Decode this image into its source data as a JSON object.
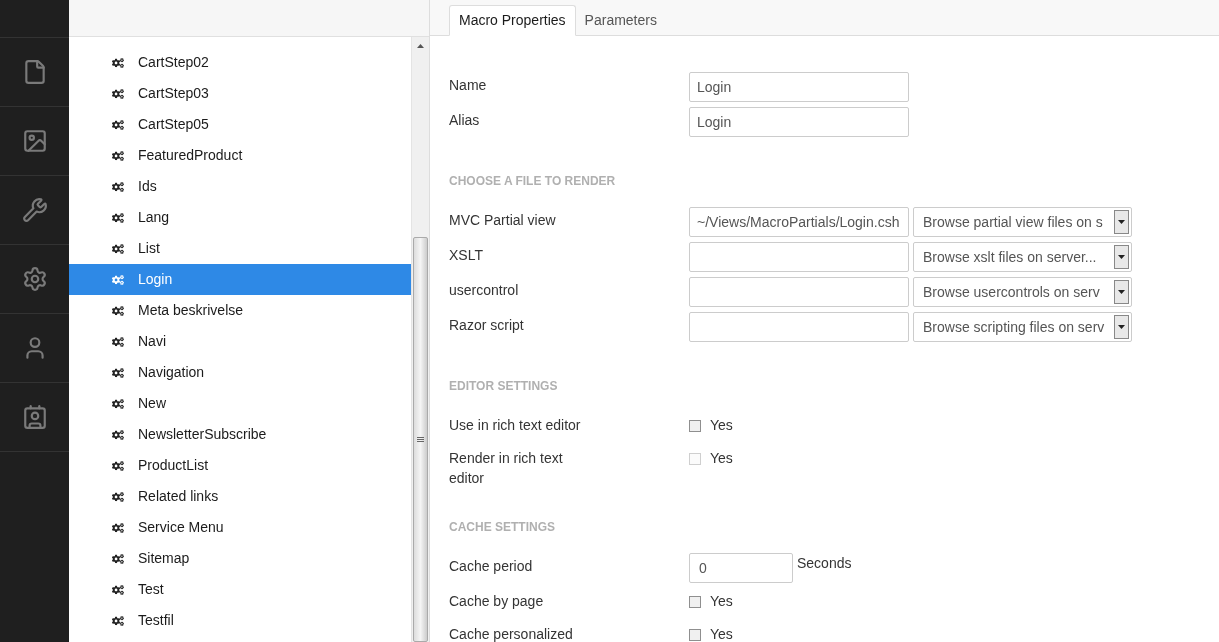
{
  "tree": {
    "items": [
      {
        "label": "CartStep02",
        "selected": false
      },
      {
        "label": "CartStep03",
        "selected": false
      },
      {
        "label": "CartStep05",
        "selected": false
      },
      {
        "label": "FeaturedProduct",
        "selected": false
      },
      {
        "label": "Ids",
        "selected": false
      },
      {
        "label": "Lang",
        "selected": false
      },
      {
        "label": "List",
        "selected": false
      },
      {
        "label": "Login",
        "selected": true
      },
      {
        "label": "Meta beskrivelse",
        "selected": false
      },
      {
        "label": "Navi",
        "selected": false
      },
      {
        "label": "Navigation",
        "selected": false
      },
      {
        "label": "New",
        "selected": false
      },
      {
        "label": "NewsletterSubscribe",
        "selected": false
      },
      {
        "label": "ProductList",
        "selected": false
      },
      {
        "label": "Related links",
        "selected": false
      },
      {
        "label": "Service Menu",
        "selected": false
      },
      {
        "label": "Sitemap",
        "selected": false
      },
      {
        "label": "Test",
        "selected": false
      },
      {
        "label": "Testfil",
        "selected": false
      }
    ]
  },
  "tabs": [
    {
      "label": "Macro Properties",
      "selected": true
    },
    {
      "label": "Parameters",
      "selected": false
    }
  ],
  "sections": [
    {
      "rows": [
        {
          "kind": "text",
          "label": "Name",
          "value": "Login"
        },
        {
          "kind": "text",
          "label": "Alias",
          "value": "Login"
        }
      ]
    },
    {
      "heading": "CHOOSE A FILE TO RENDER",
      "rows": [
        {
          "kind": "file",
          "label": "MVC Partial view",
          "value": "~/Views/MacroPartials/Login.csh",
          "browse": "Browse partial view files on s"
        },
        {
          "kind": "file",
          "label": "XSLT",
          "browse": "Browse xslt files on server..."
        },
        {
          "kind": "file",
          "label": "usercontrol",
          "browse": "Browse usercontrols on serv"
        },
        {
          "kind": "file",
          "label": "Razor script",
          "browse": "Browse scripting files on serv"
        }
      ]
    },
    {
      "heading": "EDITOR SETTINGS",
      "rows": [
        {
          "kind": "checkbox",
          "label": "Use in rich text editor",
          "option": "Yes",
          "checked": false,
          "disabled": false
        },
        {
          "kind": "checkbox",
          "label": "Render in rich text editor",
          "option": "Yes",
          "checked": false,
          "disabled": true
        }
      ]
    },
    {
      "heading": "CACHE SETTINGS",
      "rows": [
        {
          "kind": "number",
          "label": "Cache period",
          "value": "0",
          "unit": "Seconds"
        },
        {
          "kind": "checkbox",
          "label": "Cache by page",
          "option": "Yes",
          "checked": false,
          "disabled": false
        },
        {
          "kind": "checkbox",
          "label": "Cache personalized",
          "option": "Yes",
          "checked": false,
          "disabled": false
        }
      ]
    }
  ]
}
